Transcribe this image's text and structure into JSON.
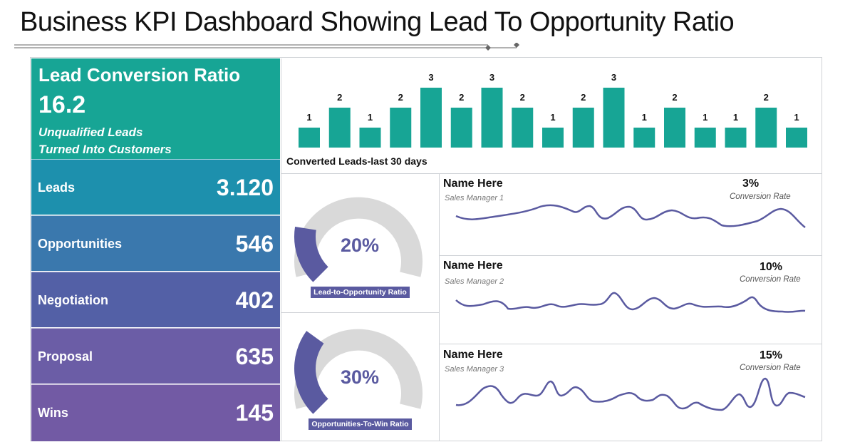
{
  "title": "Business KPI Dashboard Showing Lead To Opportunity Ratio",
  "colors": {
    "teal": "#17a595",
    "purple": "#5a5aa0",
    "gauge_bg": "#d9d9d9"
  },
  "conversion": {
    "heading": "Lead Conversion Ratio",
    "value": "16.2",
    "sub_line1": "Unqualified Leads",
    "sub_line2": "Turned Into Customers"
  },
  "kpis": [
    {
      "label": "Leads",
      "value": "3.120",
      "color": "#1d90ad"
    },
    {
      "label": "Opportunities",
      "value": "546",
      "color": "#3a78ad"
    },
    {
      "label": "Negotiation",
      "value": "402",
      "color": "#5360a6"
    },
    {
      "label": "Proposal",
      "value": "635",
      "color": "#6b5da6"
    },
    {
      "label": "Wins",
      "value": "145",
      "color": "#725aa4"
    }
  ],
  "gauges": [
    {
      "percent": "20%",
      "fraction": 0.2,
      "label": "Lead-to-Opportunity Ratio"
    },
    {
      "percent": "30%",
      "fraction": 0.3,
      "label": "Opportunities-To-Win Ratio"
    }
  ],
  "managers": [
    {
      "name": "Name Here",
      "role": "Sales Manager  1",
      "percent": "3%",
      "rate_label": "Conversion  Rate"
    },
    {
      "name": "Name Here",
      "role": "Sales Manager  2",
      "percent": "10%",
      "rate_label": "Conversion  Rate"
    },
    {
      "name": "Name Here",
      "role": "Sales Manager  3",
      "percent": "15%",
      "rate_label": "Conversion  Rate"
    }
  ],
  "chart_data": [
    {
      "type": "bar",
      "xlabel": "Converted Leads-last 30 days",
      "values": [
        1,
        2,
        1,
        2,
        3,
        2,
        3,
        2,
        1,
        2,
        3,
        1,
        2,
        1,
        1,
        2,
        1
      ],
      "ylim": [
        0,
        3
      ],
      "data_labels": true,
      "color": "#17a595"
    }
  ]
}
